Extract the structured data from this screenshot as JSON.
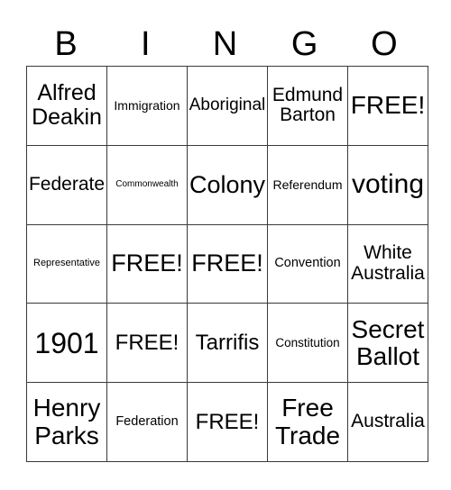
{
  "header": {
    "letters": [
      "B",
      "I",
      "N",
      "G",
      "O"
    ]
  },
  "board": {
    "rows": [
      [
        "Alfred\nDeakin",
        "Immigration",
        "Aboriginal",
        "Edmund\nBarton",
        "FREE!"
      ],
      [
        "Federate",
        "Commonwealth",
        "Colony",
        "Referendum",
        "voting"
      ],
      [
        "Representative",
        "FREE!",
        "FREE!",
        "Convention",
        "White\nAustralia"
      ],
      [
        "1901",
        "FREE!",
        "Tarrifis",
        "Constitution",
        "Secret\nBallot"
      ],
      [
        "Henry\nParks",
        "Federation",
        "FREE!",
        "Free\nTrade",
        "Australia"
      ]
    ]
  }
}
